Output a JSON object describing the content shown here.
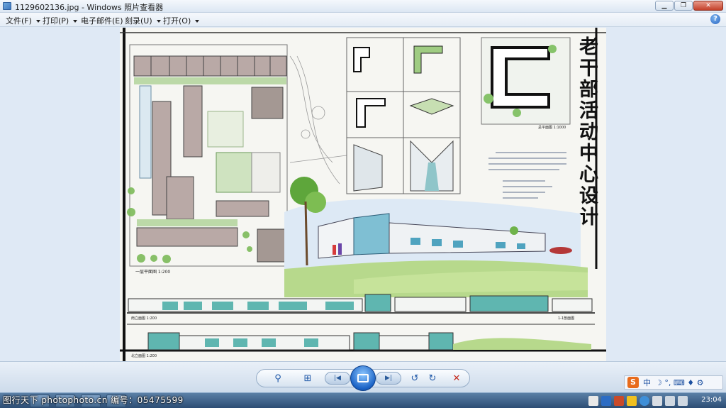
{
  "window": {
    "title": "1129602136.jpg - Windows 照片查看器"
  },
  "menu": {
    "file": "文件(F)",
    "print": "打印(P)",
    "email": "电子邮件(E)",
    "burn": "刻录(U)",
    "open": "打开(O)",
    "help": "?"
  },
  "drawing": {
    "vertical_title": [
      "老",
      "干",
      "部",
      "活",
      "动",
      "中",
      "心",
      "设",
      "计"
    ],
    "label_ground_floor": "一层平面图 1:200",
    "label_south_elev": "南立面图 1:200",
    "label_north_elev": "北立面图 1:200",
    "label_site": "总平面图 1:1000",
    "label_section": "1-1剖面图"
  },
  "ime": {
    "logo": "S",
    "mode": "中",
    "symbols": "☽ °, ⌨ ♦ ⚙"
  },
  "taskbar": {
    "watermark": "图行天下 photophoto.cn  编号：05475599",
    "clock": "23:04"
  }
}
